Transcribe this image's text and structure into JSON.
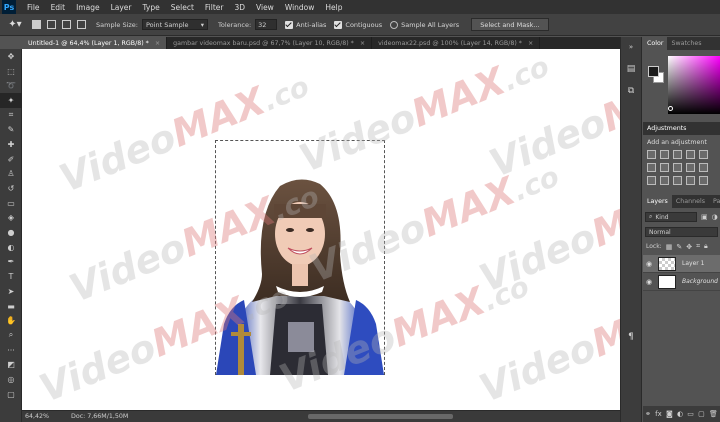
{
  "app": {
    "logo": "Ps"
  },
  "menu": [
    "File",
    "Edit",
    "Image",
    "Layer",
    "Type",
    "Select",
    "Filter",
    "3D",
    "View",
    "Window",
    "Help"
  ],
  "options": {
    "sample_size_label": "Sample Size:",
    "sample_size_value": "Point Sample",
    "tolerance_label": "Tolerance:",
    "tolerance_value": "32",
    "anti_alias_label": "Anti-alias",
    "contiguous_label": "Contiguous",
    "sample_all_layers_label": "Sample All Layers",
    "select_mask_label": "Select and Mask..."
  },
  "tabs": [
    {
      "label": "Untitled-1 @ 64,4% (Layer 1, RGB/8) *",
      "close": "×"
    },
    {
      "label": "gambar videomax baru.psd @ 67,7% (Layer 10, RGB/8) *",
      "close": "×"
    },
    {
      "label": "videomax22.psd @ 100% (Layer 14, RGB/8) *",
      "close": "×"
    }
  ],
  "watermark": {
    "a": "Video",
    "b": "MAX",
    "c": ".co"
  },
  "status": {
    "zoom": "64,42%",
    "doc": "Doc: 7,66M/1,50M"
  },
  "panels": {
    "color_tab": "Color",
    "swatches_tab": "Swatches",
    "adjustments_tab": "Adjustments",
    "add_adjustment": "Add an adjustment",
    "layers_tab": "Layers",
    "channels_tab": "Channels",
    "paths_tab": "Path",
    "kind_label": "Kind",
    "blend_mode": "Normal",
    "lock_label": "Lock:",
    "layers": [
      {
        "name": "Layer 1",
        "selected": true
      },
      {
        "name": "Background",
        "selected": false
      }
    ]
  }
}
